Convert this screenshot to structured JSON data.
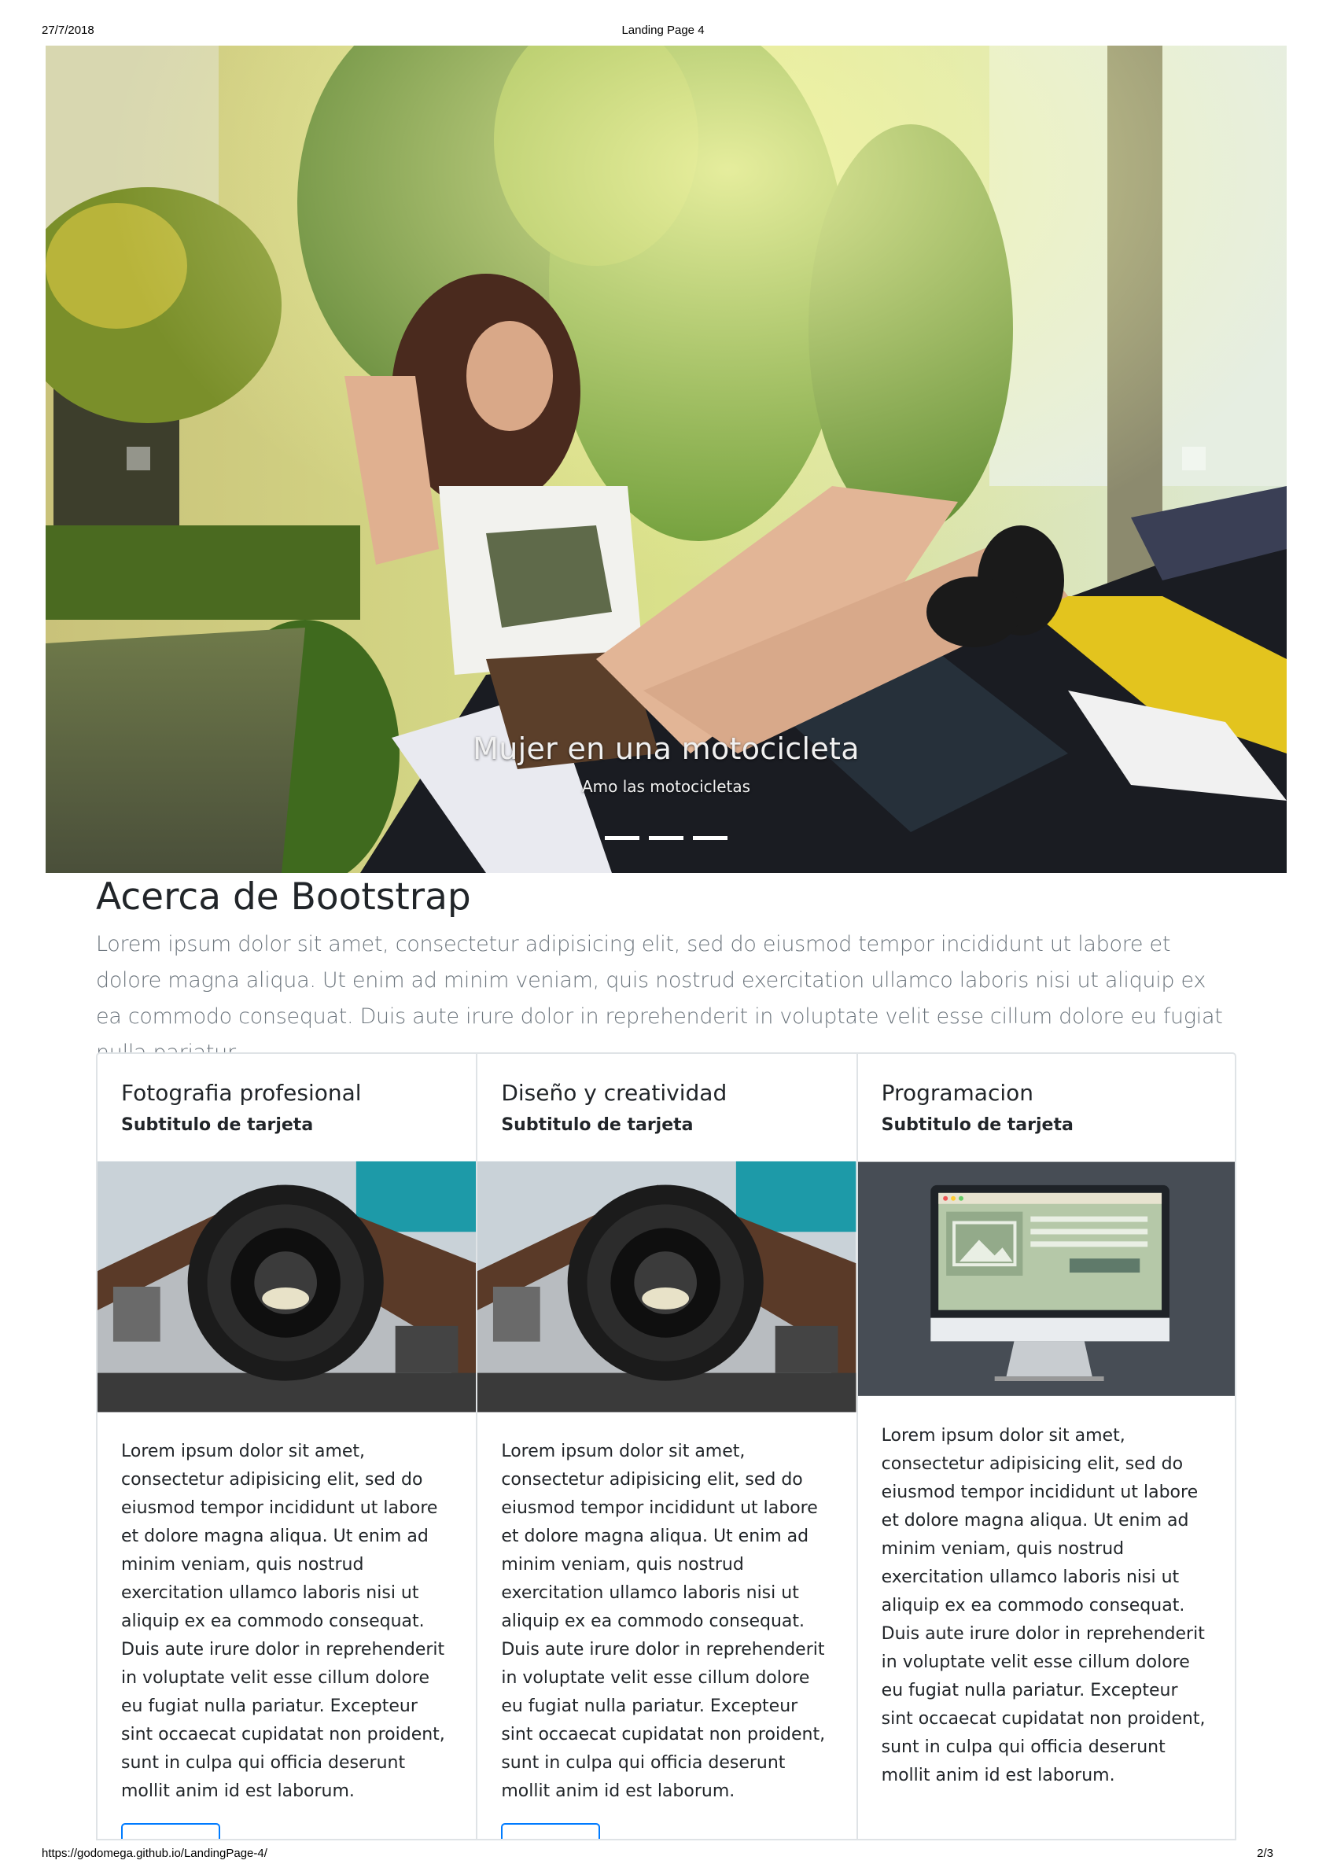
{
  "print": {
    "date": "27/7/2018",
    "title": "Landing Page 4",
    "url": "https://godomega.github.io/LandingPage-4/",
    "page": "2/3"
  },
  "carousel": {
    "caption_title": "Mujer en una motocicleta",
    "caption_text": "Amo las motocicletas",
    "indicator_count": 3
  },
  "about": {
    "title": "Acerca de Bootstrap",
    "lead": "Lorem ipsum dolor sit amet, consectetur adipisicing elit, sed do eiusmod tempor incididunt ut labore et dolore magna aliqua. Ut enim ad minim veniam, quis nostrud exercitation ullamco laboris nisi ut aliquip ex ea commodo consequat. Duis aute irure dolor in reprehenderit in voluptate velit esse cillum dolore eu fugiat nulla pariatur."
  },
  "cards": [
    {
      "title": "Fotografia profesional",
      "subtitle": "Subtitulo de tarjeta",
      "image_icon": "camera-photo",
      "text": "Lorem ipsum dolor sit amet, consectetur adipisicing elit, sed do eiusmod tempor incididunt ut labore et dolore magna aliqua. Ut enim ad minim veniam, quis nostrud exercitation ullamco laboris nisi ut aliquip ex ea commodo consequat. Duis aute irure dolor in reprehenderit in voluptate velit esse cillum dolore eu fugiat nulla pariatur. Excepteur sint occaecat cupidatat non proident, sunt in culpa qui officia deserunt mollit anim id est laborum."
    },
    {
      "title": "Diseño y creatividad",
      "subtitle": "Subtitulo de tarjeta",
      "image_icon": "camera-photo",
      "text": "Lorem ipsum dolor sit amet, consectetur adipisicing elit, sed do eiusmod tempor incididunt ut labore et dolore magna aliqua. Ut enim ad minim veniam, quis nostrud exercitation ullamco laboris nisi ut aliquip ex ea commodo consequat. Duis aute irure dolor in reprehenderit in voluptate velit esse cillum dolore eu fugiat nulla pariatur. Excepteur sint occaecat cupidatat non proident, sunt in culpa qui officia deserunt mollit anim id est laborum."
    },
    {
      "title": "Programacion",
      "subtitle": "Subtitulo de tarjeta",
      "image_icon": "monitor-illustration",
      "text": "Lorem ipsum dolor sit amet, consectetur adipisicing elit, sed do eiusmod tempor incididunt ut labore et dolore magna aliqua. Ut enim ad minim veniam, quis nostrud exercitation ullamco laboris nisi ut aliquip ex ea commodo consequat. Duis aute irure dolor in reprehenderit in voluptate velit esse cillum dolore eu fugiat nulla pariatur. Excepteur sint occaecat cupidatat non proident, sunt in culpa qui officia deserunt mollit anim id est laborum."
    }
  ],
  "colors": {
    "button_border": "#007bff",
    "lead_text": "#6c757d",
    "card_border": "#dfe3e6"
  }
}
